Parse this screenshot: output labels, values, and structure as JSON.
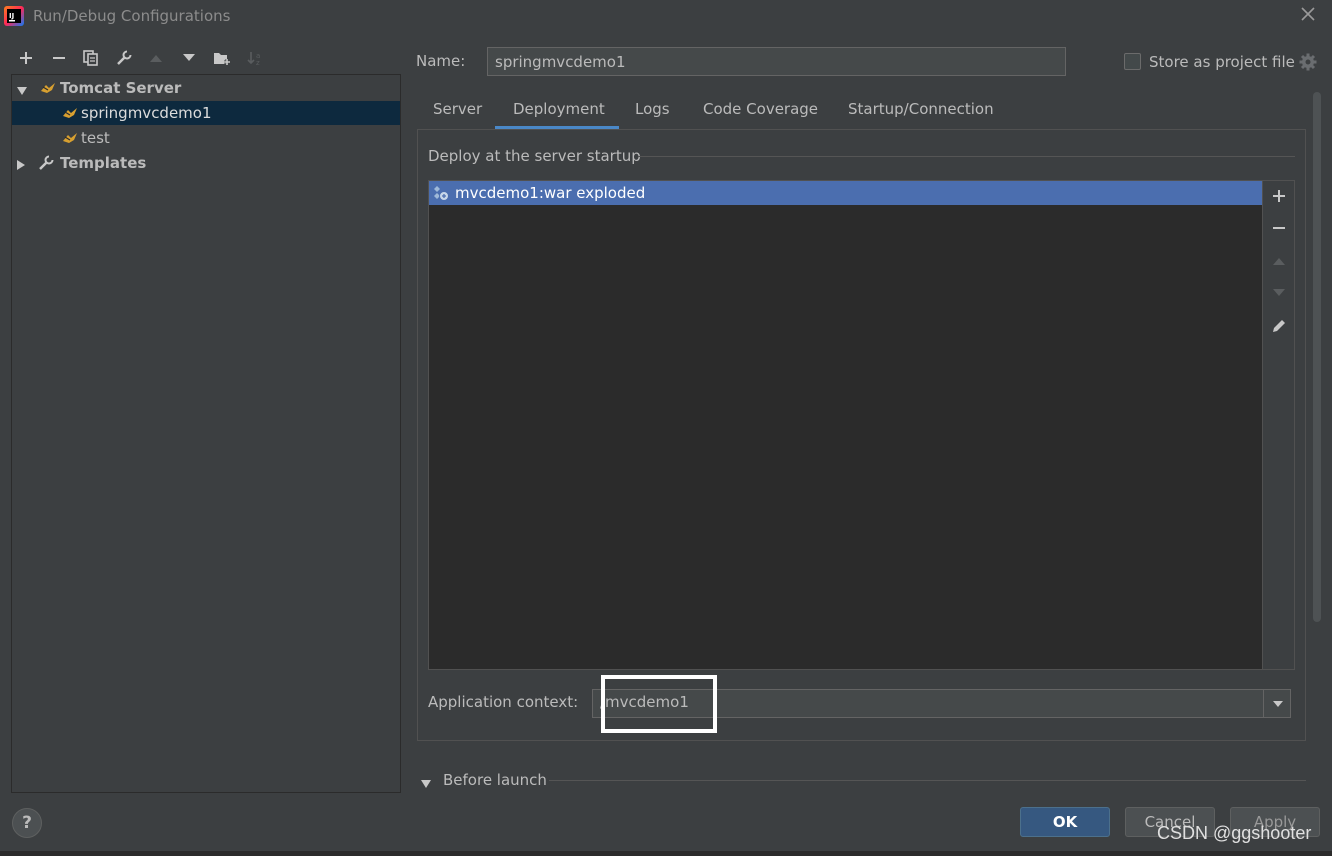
{
  "window": {
    "title": "Run/Debug Configurations"
  },
  "tree": {
    "nodes": [
      {
        "label": "Tomcat Server",
        "expanded": true
      },
      {
        "label": "springmvcdemo1",
        "selected": true
      },
      {
        "label": "test"
      },
      {
        "label": "Templates",
        "expanded": false
      }
    ]
  },
  "form": {
    "name_label": "Name:",
    "name_value": "springmvcdemo1",
    "store_label": "Store as project file",
    "store_checked": false
  },
  "tabs": [
    {
      "label": "Server"
    },
    {
      "label": "Deployment",
      "active": true
    },
    {
      "label": "Logs"
    },
    {
      "label": "Code Coverage"
    },
    {
      "label": "Startup/Connection"
    }
  ],
  "deployment": {
    "section_title": "Deploy at the server startup",
    "items": [
      "mvcdemo1:war exploded"
    ],
    "context_label": "Application context:",
    "context_value": "/mvcdemo1"
  },
  "before_launch": {
    "label": "Before launch"
  },
  "buttons": {
    "ok": "OK",
    "cancel": "Cancel",
    "apply": "Apply",
    "help": "?"
  },
  "watermark": "CSDN @ggshooter",
  "colors": {
    "background": "#3c3f41",
    "selection": "#4b6eaf",
    "tree_selection": "#0d293e",
    "accent": "#4a88c7",
    "ok_button": "#365880"
  }
}
